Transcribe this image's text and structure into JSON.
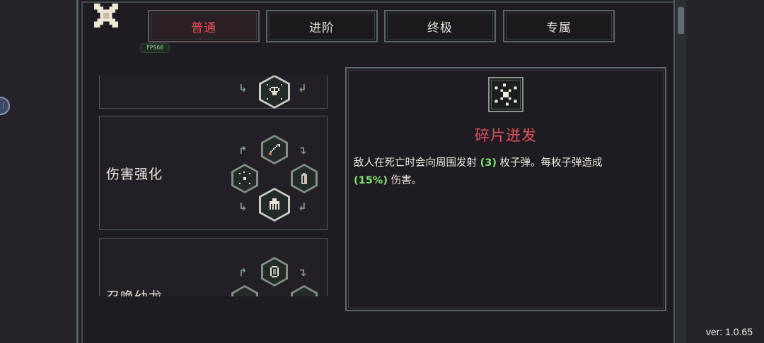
{
  "tabs": [
    {
      "label": "普通"
    },
    {
      "label": "进阶"
    },
    {
      "label": "终极"
    },
    {
      "label": "专属"
    }
  ],
  "fps_label": "FPS60",
  "upgrade_list": [
    {
      "title": ""
    },
    {
      "title": "伤害强化"
    },
    {
      "title": "召唤幼龙"
    }
  ],
  "detail": {
    "title": "碎片迸发",
    "desc_part1": "敌人在死亡时会向周围发射",
    "bullet_count": "(3)",
    "desc_part2": " 枚子弹。每枚子弹造成",
    "damage": "(15%)",
    "desc_part3": " 伤害。"
  },
  "version": "ver: 1.0.65",
  "colors": {
    "accent_red": "#e0515a",
    "highlight_green": "#7ae26a",
    "frame": "#58696d",
    "background": "#1f1b22"
  },
  "icons": {
    "close": "close-x-icon",
    "shard_burst": "shard-burst-icon",
    "skull": "skull-icon",
    "dagger": "dagger-icon",
    "bullet": "bullet-icon",
    "claw": "claw-icon",
    "egg": "dragon-egg-icon"
  }
}
